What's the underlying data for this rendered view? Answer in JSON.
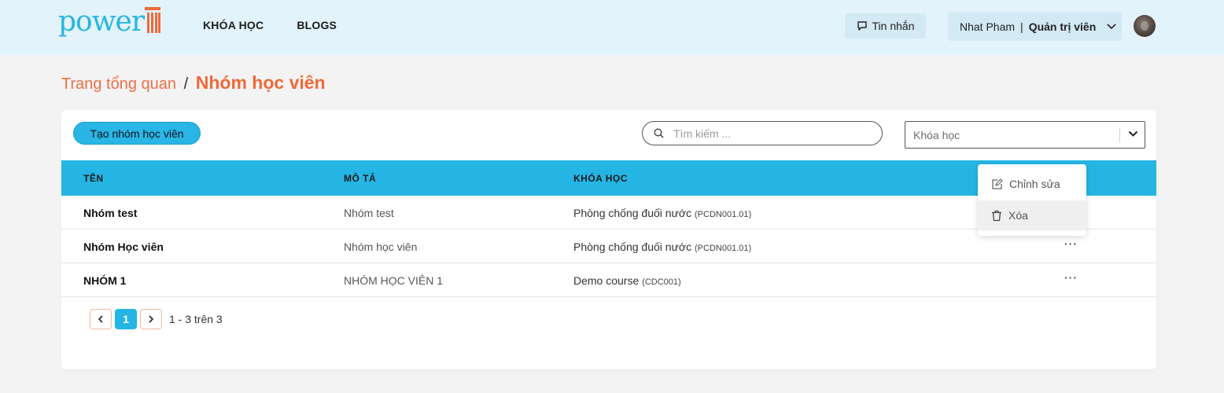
{
  "header": {
    "logo_text": "power",
    "nav": [
      {
        "label": "KHÓA HỌC"
      },
      {
        "label": "BLOGS"
      }
    ],
    "messages_label": "Tin nhắn",
    "user_name": "Nhat Pham",
    "user_separator": "|",
    "user_role": "Quản trị viên"
  },
  "breadcrumb": {
    "parent": "Trang tổng quan",
    "separator": "/",
    "current": "Nhóm học viên"
  },
  "toolbar": {
    "create_label": "Tạo nhóm học viên",
    "search_placeholder": "Tìm kiếm ...",
    "course_select_placeholder": "Khóa học"
  },
  "table": {
    "columns": [
      "TÊN",
      "MÔ TẢ",
      "KHÓA HỌC"
    ],
    "rows": [
      {
        "name": "Nhóm test",
        "description": "Nhóm test",
        "course": "Phòng chống đuối nước",
        "course_code": "(PCDN001.01)",
        "more": "···"
      },
      {
        "name": "Nhóm Học viên",
        "description": "Nhóm học viên",
        "course": "Phòng chống đuối nước",
        "course_code": "(PCDN001.01)",
        "more": "···"
      },
      {
        "name": "NHÓM 1",
        "description": "NHÓM HỌC VIÊN 1",
        "course": "Demo course",
        "course_code": "(CDC001)",
        "more": "···"
      }
    ]
  },
  "pagination": {
    "current_page": "1",
    "info": "1 - 3 trên 3"
  },
  "row_menu": {
    "edit_label": "Chỉnh sửa",
    "delete_label": "Xóa"
  },
  "colors": {
    "accent_blue": "#25b5e4",
    "accent_orange": "#ee6a38",
    "header_bg": "#e2f3fb"
  },
  "icons": [
    "chat-icon",
    "chevron-down-icon",
    "search-icon",
    "chevron-left-icon",
    "chevron-right-icon",
    "edit-icon",
    "trash-icon"
  ]
}
